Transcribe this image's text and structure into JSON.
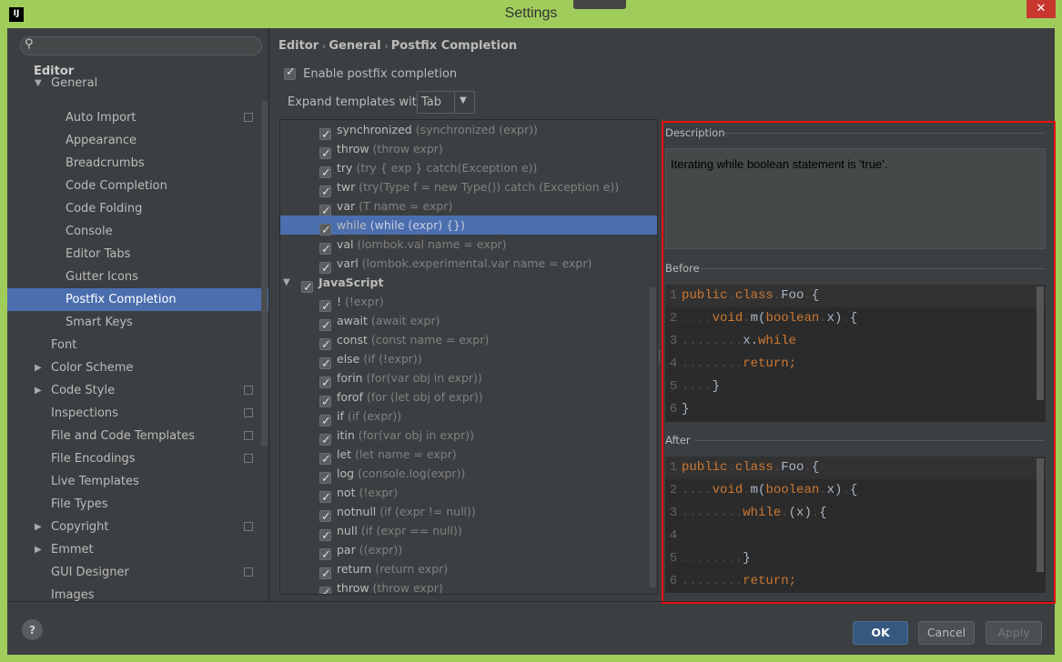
{
  "window": {
    "title": "Settings",
    "app_icon": "IJ",
    "close": "✕"
  },
  "sidebar": {
    "search_placeholder": "",
    "section": "Editor",
    "items": [
      {
        "label": "General",
        "level": 1,
        "expanded": true
      },
      {
        "label": "Auto Import",
        "level": 2,
        "copy": true
      },
      {
        "label": "Appearance",
        "level": 2
      },
      {
        "label": "Breadcrumbs",
        "level": 2
      },
      {
        "label": "Code Completion",
        "level": 2
      },
      {
        "label": "Code Folding",
        "level": 2
      },
      {
        "label": "Console",
        "level": 2
      },
      {
        "label": "Editor Tabs",
        "level": 2
      },
      {
        "label": "Gutter Icons",
        "level": 2
      },
      {
        "label": "Postfix Completion",
        "level": 2,
        "selected": true
      },
      {
        "label": "Smart Keys",
        "level": 2
      },
      {
        "label": "Font",
        "level": 1
      },
      {
        "label": "Color Scheme",
        "level": 1,
        "collapsed": true
      },
      {
        "label": "Code Style",
        "level": 1,
        "collapsed": true,
        "copy": true
      },
      {
        "label": "Inspections",
        "level": 1,
        "copy": true
      },
      {
        "label": "File and Code Templates",
        "level": 1,
        "copy": true
      },
      {
        "label": "File Encodings",
        "level": 1,
        "copy": true
      },
      {
        "label": "Live Templates",
        "level": 1
      },
      {
        "label": "File Types",
        "level": 1
      },
      {
        "label": "Copyright",
        "level": 1,
        "collapsed": true,
        "copy": true
      },
      {
        "label": "Emmet",
        "level": 1,
        "collapsed": true
      },
      {
        "label": "GUI Designer",
        "level": 1,
        "copy": true
      },
      {
        "label": "Images",
        "level": 1
      }
    ]
  },
  "breadcrumb": [
    "Editor",
    "General",
    "Postfix Completion"
  ],
  "enable_label": "Enable postfix completion",
  "enable_checked": true,
  "expand_label": "Expand templates with",
  "expand_value": "Tab",
  "templates": [
    {
      "name": "synchronized",
      "hint": "(synchronized (expr))"
    },
    {
      "name": "throw",
      "hint": "(throw expr)"
    },
    {
      "name": "try",
      "hint": "(try { exp } catch(Exception e))"
    },
    {
      "name": "twr",
      "hint": "(try(Type f = new Type()) catch (Exception e))"
    },
    {
      "name": "var",
      "hint": "(T name = expr)"
    },
    {
      "name": "while",
      "hint": "(while (expr) {})",
      "selected": true
    },
    {
      "name": "val",
      "hint": "(lombok.val name = expr)"
    },
    {
      "name": "varl",
      "hint": "(lombok.experimental.var name = expr)"
    },
    {
      "name": "JavaScript",
      "group": true
    },
    {
      "name": "!",
      "hint": "(!expr)"
    },
    {
      "name": "await",
      "hint": "(await expr)"
    },
    {
      "name": "const",
      "hint": "(const name = expr)"
    },
    {
      "name": "else",
      "hint": "(if (!expr))"
    },
    {
      "name": "forin",
      "hint": "(for(var obj in expr))"
    },
    {
      "name": "forof",
      "hint": "(for (let obj of expr))"
    },
    {
      "name": "if",
      "hint": "(if (expr))"
    },
    {
      "name": "itin",
      "hint": "(for(var obj in expr))"
    },
    {
      "name": "let",
      "hint": "(let name = expr)"
    },
    {
      "name": "log",
      "hint": "(console.log(expr))"
    },
    {
      "name": "not",
      "hint": "(!expr)"
    },
    {
      "name": "notnull",
      "hint": "(if (expr != null))"
    },
    {
      "name": "null",
      "hint": "(if (expr == null))"
    },
    {
      "name": "par",
      "hint": "((expr))"
    },
    {
      "name": "return",
      "hint": "(return expr)"
    },
    {
      "name": "throw",
      "hint": "(throw expr)"
    }
  ],
  "description": {
    "label": "Description",
    "text": "Iterating while boolean statement is 'true'."
  },
  "before": {
    "label": "Before",
    "lines": [
      [
        [
          "kw",
          "public"
        ],
        [
          "dot",
          "."
        ],
        [
          "kw",
          "class"
        ],
        [
          "dot",
          "."
        ],
        [
          "tx",
          "Foo"
        ],
        [
          "dot",
          "."
        ],
        [
          "tx",
          "{"
        ]
      ],
      [
        [
          "dot",
          "...."
        ],
        [
          "kw",
          "void"
        ],
        [
          "dot",
          "."
        ],
        [
          "tx",
          "m("
        ],
        [
          "kw",
          "boolean"
        ],
        [
          "dot",
          "."
        ],
        [
          "tx",
          "x)"
        ],
        [
          "dot",
          "."
        ],
        [
          "tx",
          "{"
        ]
      ],
      [
        [
          "dot",
          "........"
        ],
        [
          "tx",
          "x."
        ],
        [
          "kw",
          "while"
        ]
      ],
      [
        [
          "dot",
          "........"
        ],
        [
          "kw",
          "return"
        ],
        [
          "kw",
          ";"
        ]
      ],
      [
        [
          "dot",
          "...."
        ],
        [
          "tx",
          "}"
        ]
      ],
      [
        [
          "tx",
          "}"
        ]
      ]
    ]
  },
  "after": {
    "label": "After",
    "lines": [
      [
        [
          "kw",
          "public"
        ],
        [
          "dot",
          "."
        ],
        [
          "kw",
          "class"
        ],
        [
          "dot",
          "."
        ],
        [
          "tx",
          "Foo"
        ],
        [
          "dot",
          "."
        ],
        [
          "tx",
          "{"
        ]
      ],
      [
        [
          "dot",
          "...."
        ],
        [
          "kw",
          "void"
        ],
        [
          "dot",
          "."
        ],
        [
          "tx",
          "m("
        ],
        [
          "kw",
          "boolean"
        ],
        [
          "dot",
          "."
        ],
        [
          "tx",
          "x)"
        ],
        [
          "dot",
          "."
        ],
        [
          "tx",
          "{"
        ]
      ],
      [
        [
          "dot",
          "........"
        ],
        [
          "kw",
          "while"
        ],
        [
          "dot",
          "."
        ],
        [
          "tx",
          "(x)"
        ],
        [
          "dot",
          "."
        ],
        [
          "tx",
          "{"
        ]
      ],
      [],
      [
        [
          "dot",
          "........"
        ],
        [
          "tx",
          "}"
        ]
      ],
      [
        [
          "dot",
          "........"
        ],
        [
          "kw",
          "return"
        ],
        [
          "kw",
          ";"
        ]
      ]
    ]
  },
  "buttons": {
    "ok": "OK",
    "cancel": "Cancel",
    "apply": "Apply",
    "help": "?"
  },
  "colors": {
    "accent": "#4b6eaf",
    "keyword": "#cc7832",
    "code_text": "#a9b7c6",
    "highlight_box": "#e81010",
    "window_frame": "#a0cc5c"
  }
}
